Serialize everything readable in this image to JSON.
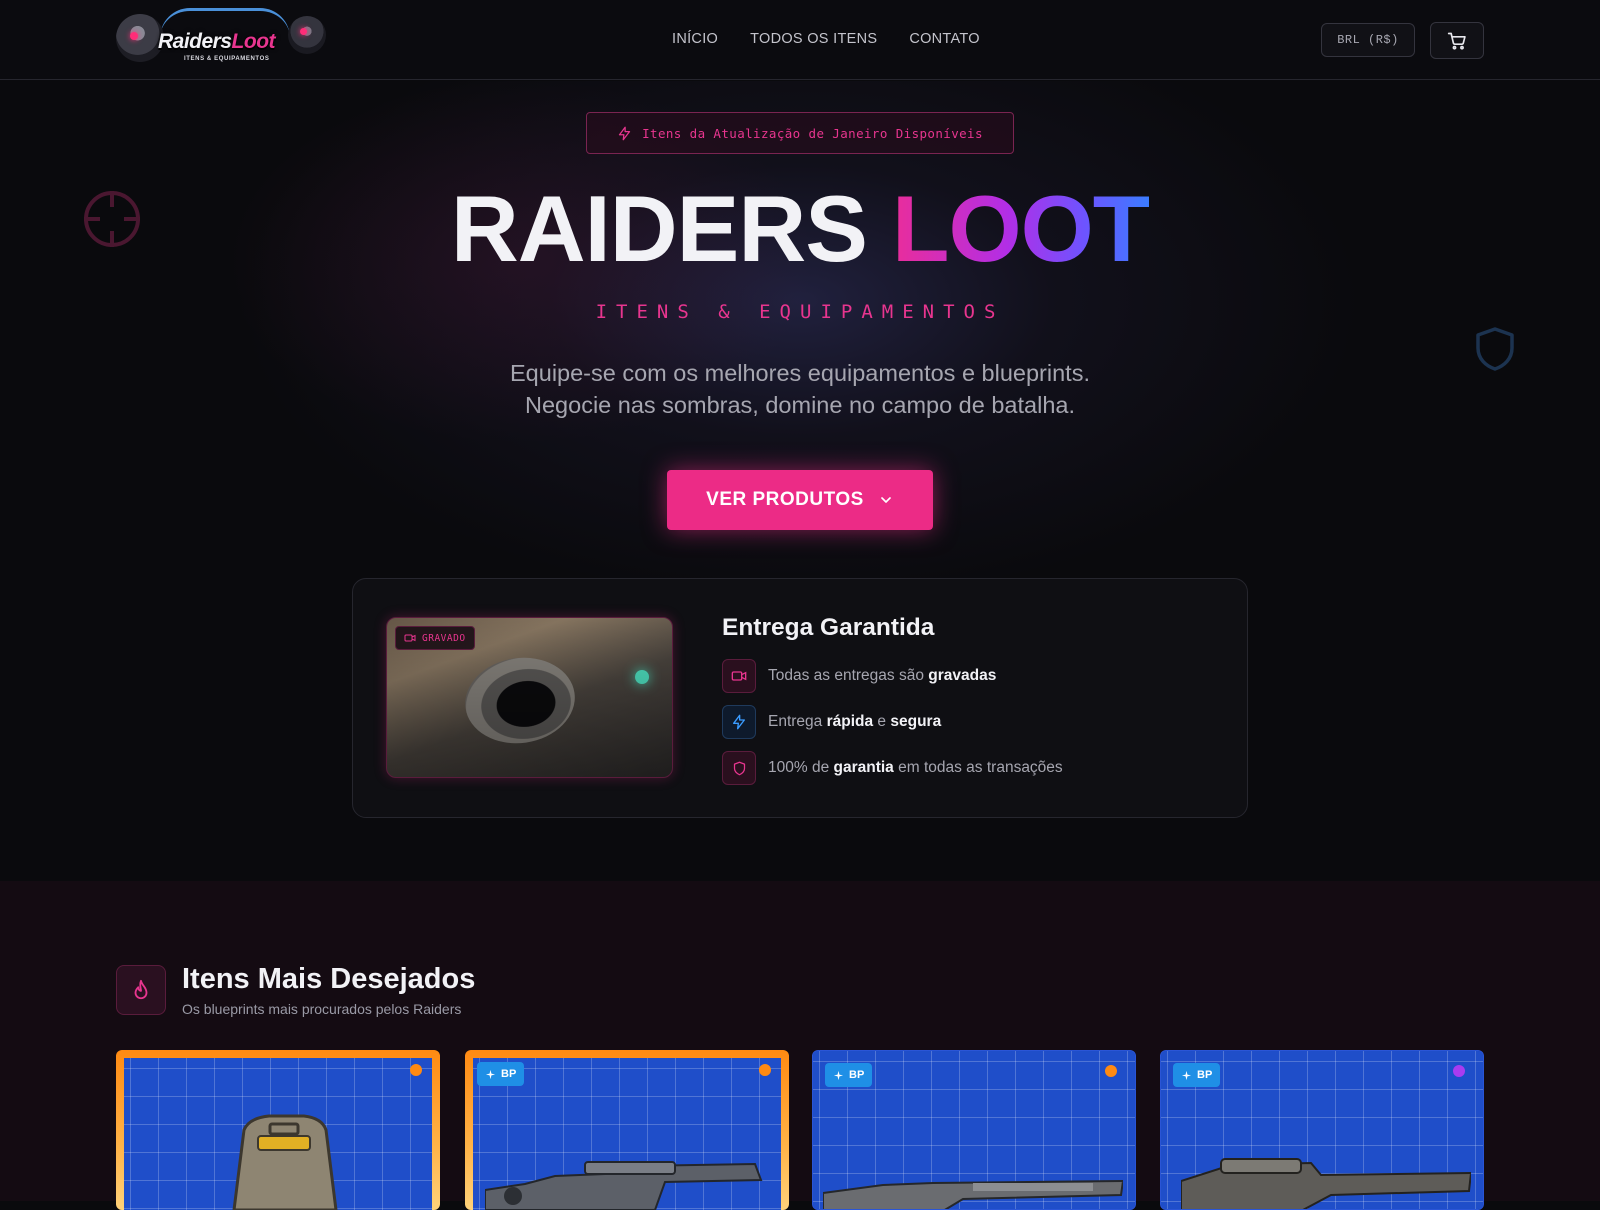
{
  "header": {
    "logo_word_a": "Raiders",
    "logo_word_b": "Loot",
    "logo_sub": "ITENS & EQUIPAMENTOS",
    "nav": [
      "INÍCIO",
      "TODOS OS ITENS",
      "CONTATO"
    ],
    "currency": "BRL (R$)"
  },
  "hero": {
    "badge": "Itens da Atualização de Janeiro Disponíveis",
    "title_a": "RAIDERS",
    "title_b": "LOOT",
    "subtitle": "ITENS & EQUIPAMENTOS",
    "desc_line1": "Equipe-se com os melhores equipamentos e blueprints.",
    "desc_line2": "Negocie nas sombras, domine no campo de batalha.",
    "cta": "VER PRODUTOS"
  },
  "delivery": {
    "video_badge": "GRAVADO",
    "title": "Entrega Garantida",
    "f1_pre": "Todas as entregas são ",
    "f1_bold": "gravadas",
    "f2_pre": "Entrega ",
    "f2_bold1": "rápida",
    "f2_mid": " e ",
    "f2_bold2": "segura",
    "f3_pre": "100% de ",
    "f3_bold": "garantia",
    "f3_post": " em todas as transações"
  },
  "most_wanted": {
    "title": "Itens Mais Desejados",
    "subtitle": "Os blueprints mais procurados pelos Raiders",
    "bp_label": "BP",
    "colors": {
      "legendary": "#ff8a12",
      "epic": "#a93cf0",
      "bp_badge": "#1f8fe6"
    }
  }
}
